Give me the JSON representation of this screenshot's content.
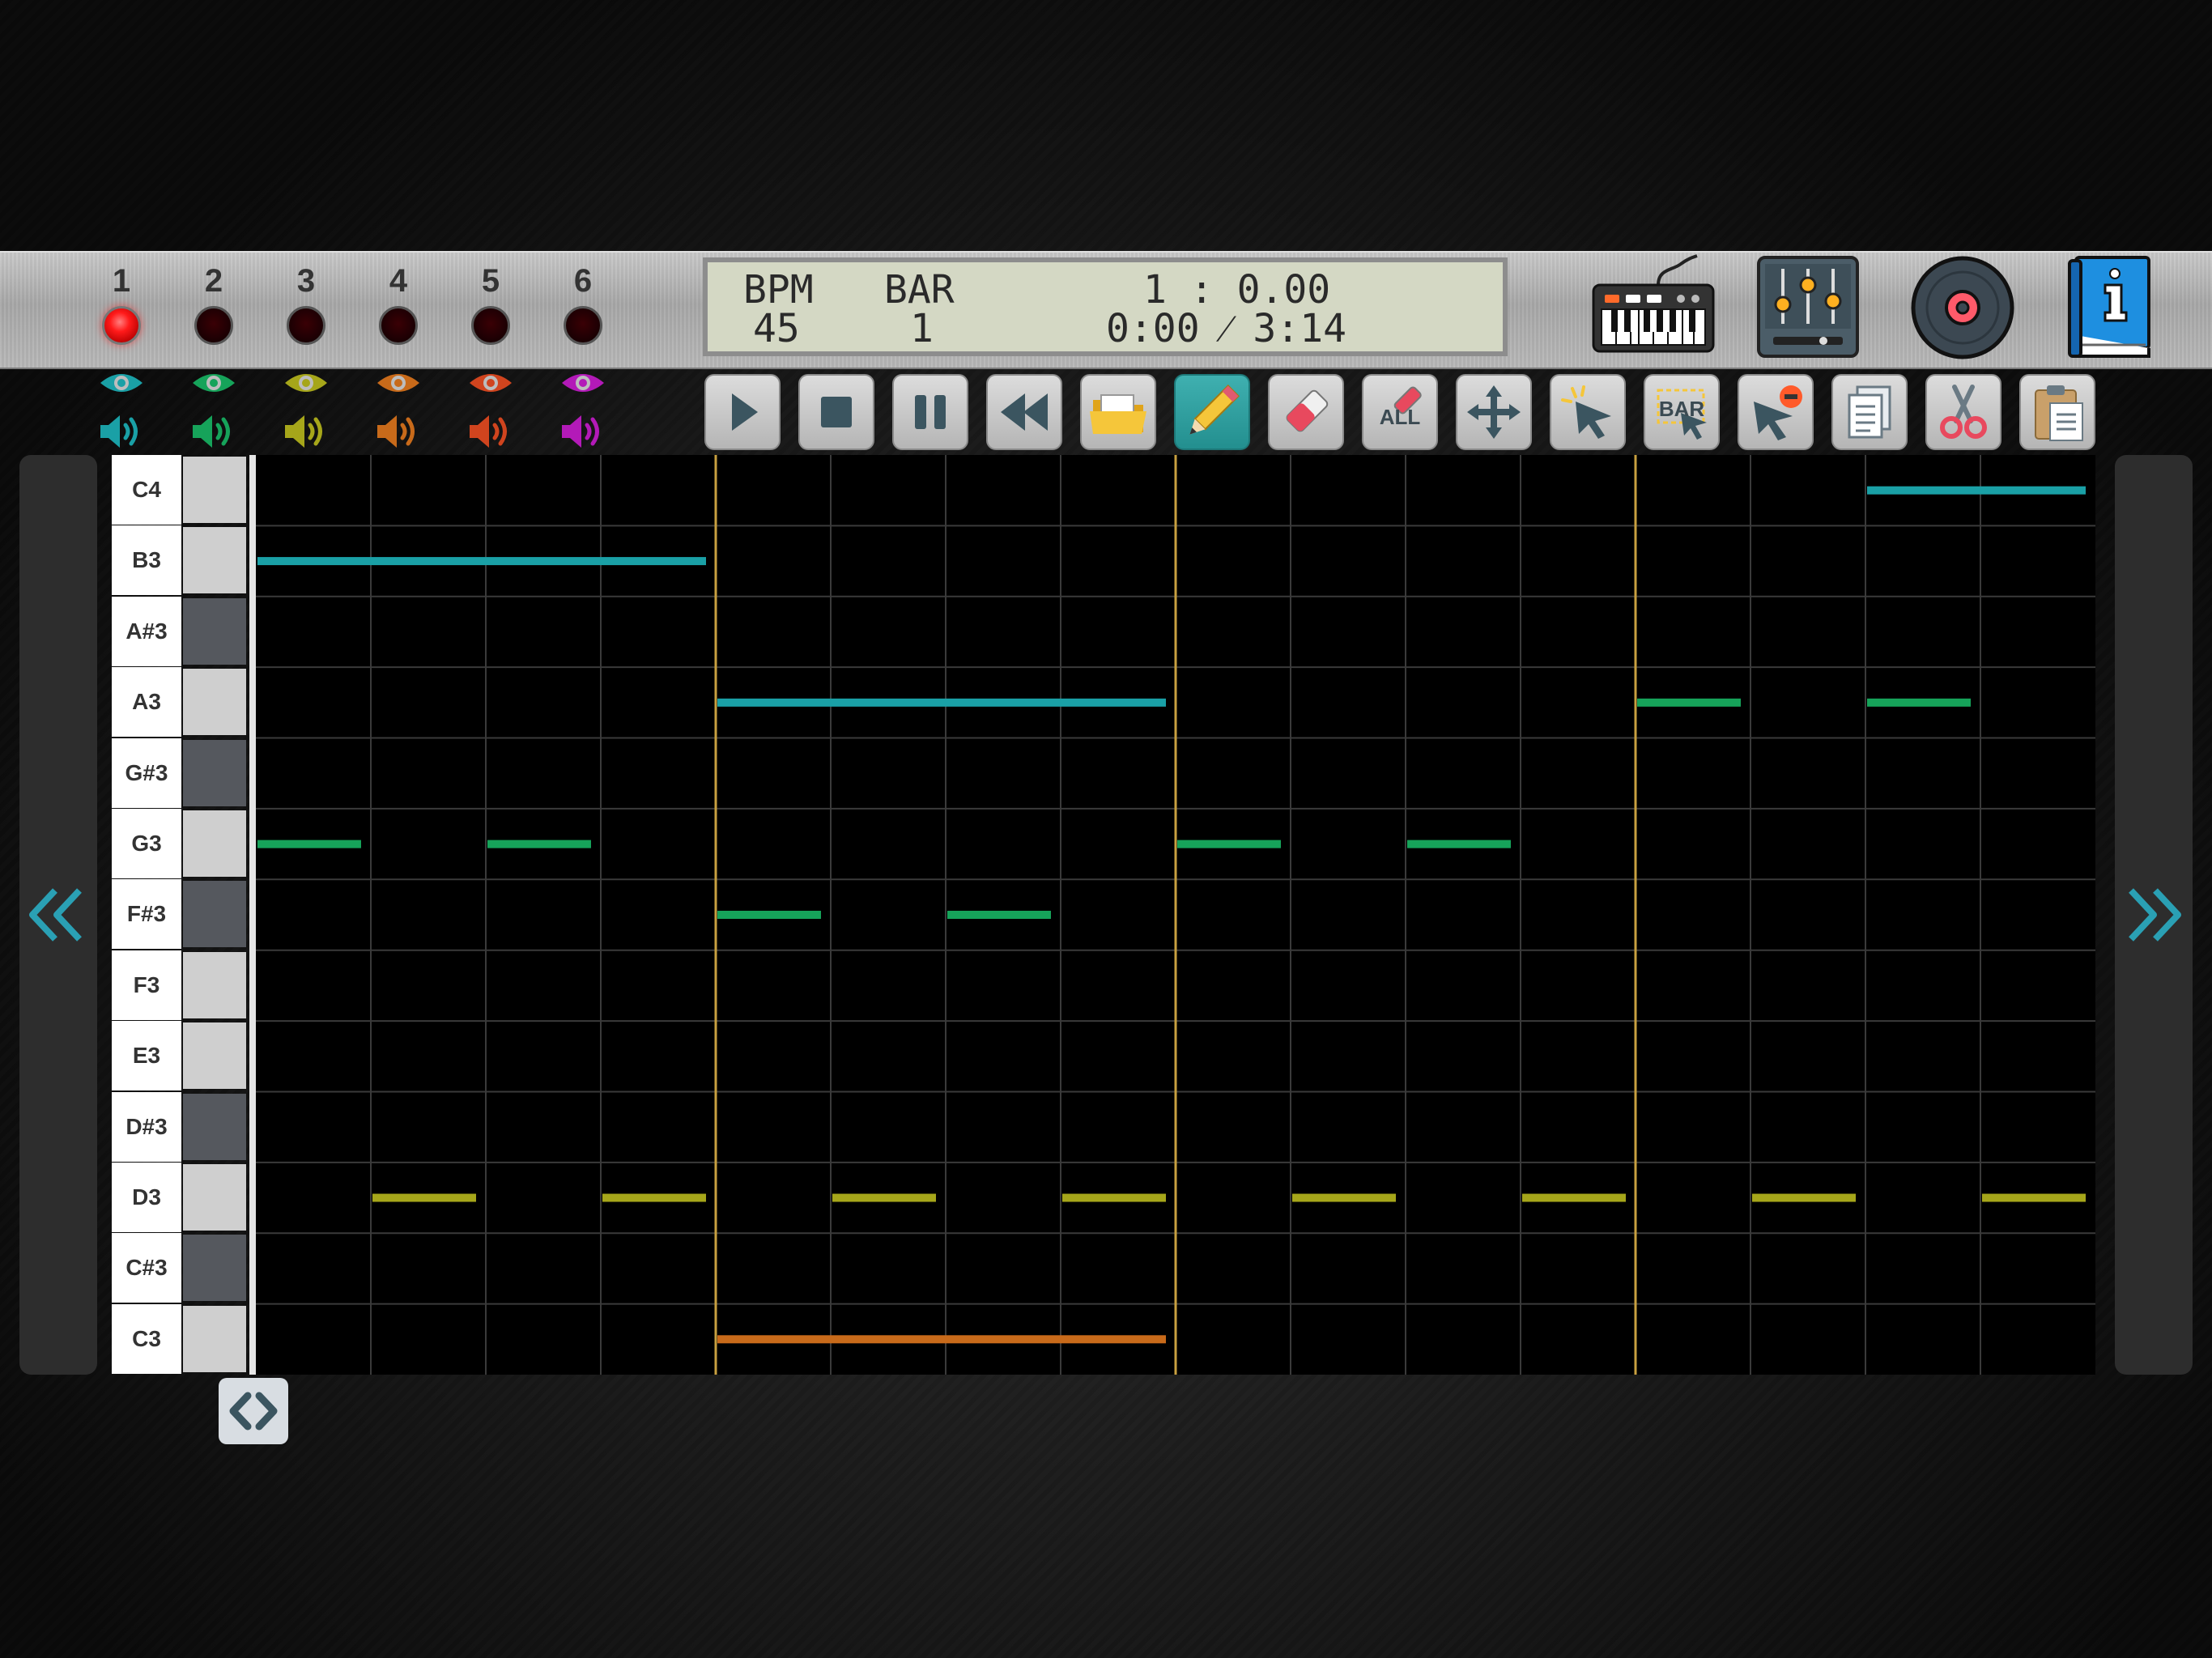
{
  "tracks": [
    {
      "number": "1",
      "color": "#1aa0a6",
      "active": true
    },
    {
      "number": "2",
      "color": "#16a35a",
      "active": false
    },
    {
      "number": "3",
      "color": "#a6a61a",
      "active": false
    },
    {
      "number": "4",
      "color": "#c86a1a",
      "active": false
    },
    {
      "number": "5",
      "color": "#d0441e",
      "active": false
    },
    {
      "number": "6",
      "color": "#b31ab8",
      "active": false
    }
  ],
  "display": {
    "bpm_label": "BPM",
    "bpm_value": "45",
    "bar_label": "BAR",
    "bar_value": "1",
    "position": "1 : 0.00",
    "time": "0:00 ⁄ 3:14"
  },
  "top_icons": [
    "keyboard-icon",
    "mixer-icon",
    "record-disc-icon",
    "info-book-icon"
  ],
  "toolbar": [
    {
      "name": "play",
      "icon": "play-icon",
      "label": ""
    },
    {
      "name": "stop",
      "icon": "stop-icon",
      "label": ""
    },
    {
      "name": "pause",
      "icon": "pause-icon",
      "label": ""
    },
    {
      "name": "rewind",
      "icon": "rewind-icon",
      "label": ""
    },
    {
      "name": "open-file",
      "icon": "folder-icon",
      "label": ""
    },
    {
      "name": "pencil",
      "icon": "pencil-icon",
      "label": "",
      "active": true
    },
    {
      "name": "eraser",
      "icon": "eraser-icon",
      "label": ""
    },
    {
      "name": "erase-all",
      "icon": "erase-all-icon",
      "label": "ALL"
    },
    {
      "name": "move",
      "icon": "move-icon",
      "label": ""
    },
    {
      "name": "select",
      "icon": "select-cursor-icon",
      "label": ""
    },
    {
      "name": "select-bar",
      "icon": "select-bar-icon",
      "label": "BAR"
    },
    {
      "name": "deselect",
      "icon": "deselect-cursor-icon",
      "label": ""
    },
    {
      "name": "copy",
      "icon": "copy-icon",
      "label": ""
    },
    {
      "name": "cut",
      "icon": "scissors-icon",
      "label": ""
    },
    {
      "name": "paste",
      "icon": "paste-icon",
      "label": ""
    }
  ],
  "piano_keys": [
    {
      "label": "C4",
      "black": false
    },
    {
      "label": "B3",
      "black": false
    },
    {
      "label": "A#3",
      "black": true
    },
    {
      "label": "A3",
      "black": false
    },
    {
      "label": "G#3",
      "black": true
    },
    {
      "label": "G3",
      "black": false
    },
    {
      "label": "F#3",
      "black": true
    },
    {
      "label": "F3",
      "black": false
    },
    {
      "label": "E3",
      "black": false
    },
    {
      "label": "D#3",
      "black": true
    },
    {
      "label": "D3",
      "black": false
    },
    {
      "label": "C#3",
      "black": true
    },
    {
      "label": "C3",
      "black": false
    }
  ],
  "roll": {
    "beats_per_bar": 4,
    "bars_visible": 4,
    "notes": [
      {
        "track": 1,
        "pitch": "B3",
        "start": 0,
        "length": 4
      },
      {
        "track": 1,
        "pitch": "A3",
        "start": 4,
        "length": 4
      },
      {
        "track": 1,
        "pitch": "C4",
        "start": 14,
        "length": 2
      },
      {
        "track": 2,
        "pitch": "G3",
        "start": 0,
        "length": 1
      },
      {
        "track": 2,
        "pitch": "G3",
        "start": 2,
        "length": 1
      },
      {
        "track": 2,
        "pitch": "F#3",
        "start": 4,
        "length": 1
      },
      {
        "track": 2,
        "pitch": "F#3",
        "start": 6,
        "length": 1
      },
      {
        "track": 2,
        "pitch": "G3",
        "start": 8,
        "length": 1
      },
      {
        "track": 2,
        "pitch": "G3",
        "start": 10,
        "length": 1
      },
      {
        "track": 2,
        "pitch": "A3",
        "start": 12,
        "length": 1
      },
      {
        "track": 2,
        "pitch": "A3",
        "start": 14,
        "length": 1
      },
      {
        "track": 3,
        "pitch": "D3",
        "start": 1,
        "length": 1
      },
      {
        "track": 3,
        "pitch": "D3",
        "start": 3,
        "length": 1
      },
      {
        "track": 3,
        "pitch": "D3",
        "start": 5,
        "length": 1
      },
      {
        "track": 3,
        "pitch": "D3",
        "start": 7,
        "length": 1
      },
      {
        "track": 3,
        "pitch": "D3",
        "start": 9,
        "length": 1
      },
      {
        "track": 3,
        "pitch": "D3",
        "start": 11,
        "length": 1
      },
      {
        "track": 3,
        "pitch": "D3",
        "start": 13,
        "length": 1
      },
      {
        "track": 3,
        "pitch": "D3",
        "start": 15,
        "length": 1
      },
      {
        "track": 4,
        "pitch": "C3",
        "start": 4,
        "length": 4
      }
    ]
  },
  "colors": {
    "bar_line": "#c8a040",
    "grid_line": "#3a3a3a",
    "accent": "#2aa6a6"
  },
  "nav": {
    "prev_icon": "double-chevron-left-icon",
    "next_icon": "double-chevron-right-icon",
    "scroll_icon": "horizontal-scroll-icon"
  }
}
